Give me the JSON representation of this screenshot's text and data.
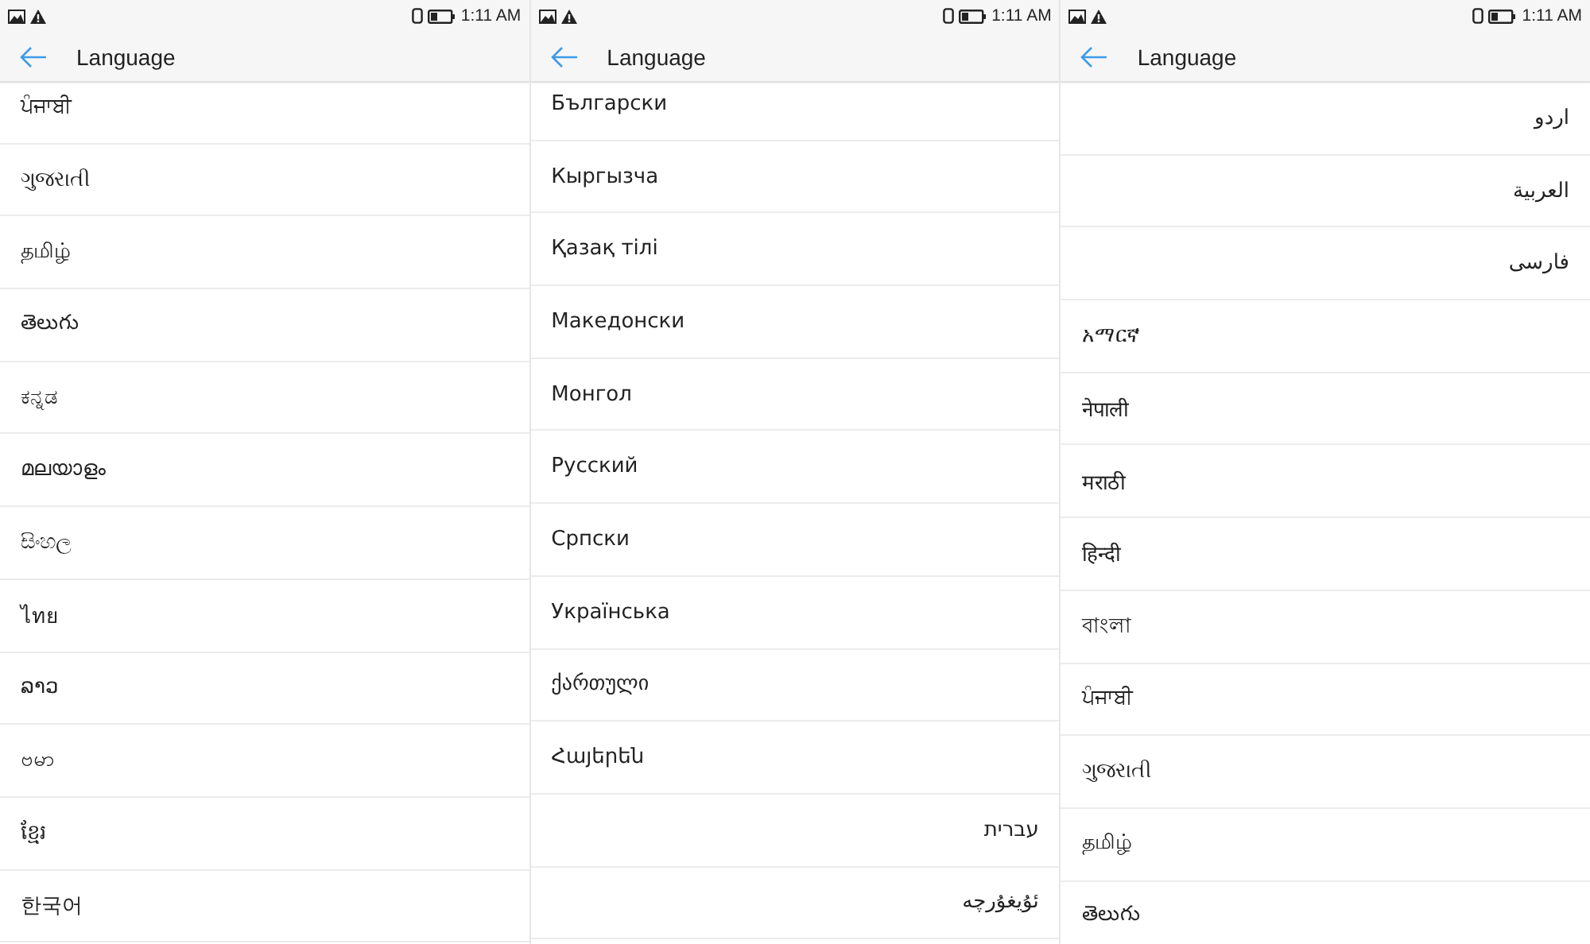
{
  "left_screen": {
    "status_bar": {
      "time": "1:11 AM"
    },
    "header": {
      "title": "Language"
    },
    "languages": [
      {
        "label": "ਪੰਜਾਬੀ",
        "right_aligned": false
      },
      {
        "label": "ગુજરાતી",
        "right_aligned": false
      },
      {
        "label": "தமிழ்",
        "right_aligned": false
      },
      {
        "label": "తెలుగు",
        "right_aligned": false
      },
      {
        "label": "ಕನ್ನಡ",
        "right_aligned": false
      },
      {
        "label": "മലയാളം",
        "right_aligned": false
      },
      {
        "label": "සිංහල",
        "right_aligned": false
      },
      {
        "label": "ไทย",
        "right_aligned": false
      },
      {
        "label": "ລາວ",
        "right_aligned": false
      },
      {
        "label": "ဗမာ",
        "right_aligned": false
      },
      {
        "label": "ខ្មែរ",
        "right_aligned": false
      },
      {
        "label": "한국어",
        "right_aligned": false
      }
    ]
  },
  "middle_screen": {
    "status_bar": {
      "time": "1:11 AM"
    },
    "header": {
      "title": "Language"
    },
    "languages": [
      {
        "label": "Български",
        "right_aligned": false
      },
      {
        "label": "Кыргызча",
        "right_aligned": false
      },
      {
        "label": "Қазақ тілі",
        "right_aligned": false
      },
      {
        "label": "Македонски",
        "right_aligned": false
      },
      {
        "label": "Монгол",
        "right_aligned": false
      },
      {
        "label": "Русский",
        "right_aligned": false
      },
      {
        "label": "Српски",
        "right_aligned": false
      },
      {
        "label": "Українська",
        "right_aligned": false
      },
      {
        "label": "ქართული",
        "right_aligned": false
      },
      {
        "label": "Հայերեն",
        "right_aligned": false
      },
      {
        "label": "עברית",
        "right_aligned": true
      },
      {
        "label": "ئۇيغۇرچە",
        "right_aligned": true
      }
    ]
  },
  "right_screen": {
    "status_bar": {
      "time": "1:11 AM"
    },
    "header": {
      "title": "Language"
    },
    "languages": [
      {
        "label": "اردو",
        "right_aligned": true
      },
      {
        "label": "العربية",
        "right_aligned": true
      },
      {
        "label": "فارسی",
        "right_aligned": true
      },
      {
        "label": "አማርኛ",
        "right_aligned": false
      },
      {
        "label": "नेपाली",
        "right_aligned": false
      },
      {
        "label": "मराठी",
        "right_aligned": false
      },
      {
        "label": "हिन्दी",
        "right_aligned": false
      },
      {
        "label": "বাংলা",
        "right_aligned": false
      },
      {
        "label": "ਪੰਜਾਬੀ",
        "right_aligned": false
      },
      {
        "label": "ગુજરાતી",
        "right_aligned": false
      },
      {
        "label": "தமிழ்",
        "right_aligned": false
      },
      {
        "label": "తెలుగు",
        "right_aligned": false
      }
    ]
  }
}
